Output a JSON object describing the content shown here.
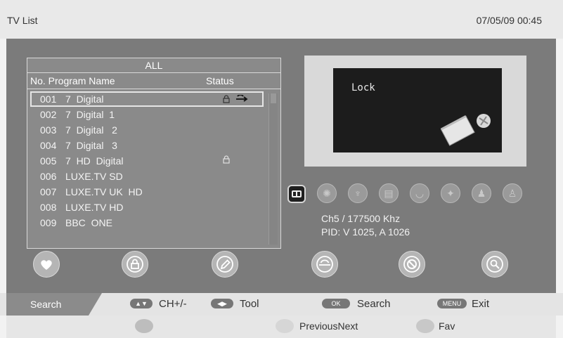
{
  "header": {
    "title": "TV List",
    "datetime": "07/05/09  00:45"
  },
  "list": {
    "group": "ALL",
    "col_no_name": "No. Program Name",
    "col_status": "Status",
    "channels": [
      {
        "no": "001",
        "name": "7  Digital",
        "locked": true,
        "skip": true
      },
      {
        "no": "002",
        "name": "7  Digital  1"
      },
      {
        "no": "003",
        "name": "7  Digital   2"
      },
      {
        "no": "004",
        "name": "7  Digital   3"
      },
      {
        "no": "005",
        "name": "7  HD  Digital",
        "locked": true
      },
      {
        "no": "006",
        "name": "LUXE.TV SD"
      },
      {
        "no": "007",
        "name": "LUXE.TV UK  HD"
      },
      {
        "no": "008",
        "name": "LUXE.TV HD"
      },
      {
        "no": "009",
        "name": "BBC  ONE"
      }
    ]
  },
  "preview": {
    "status_text": "Lock"
  },
  "info": {
    "frequency": "Ch5 / 177500  Khz",
    "pid": "PID: V 1025, A 1026"
  },
  "help": {
    "search_label": "Search",
    "ch_key": "▲▼",
    "ch_label": "CH+/-",
    "tool_key": "◀▶",
    "tool_label": "Tool",
    "ok_key": "OK",
    "ok_label": "Search",
    "menu_key": "MENU",
    "menu_label": "Exit"
  },
  "colors_hint": {
    "prevnext_label": "PreviousNext",
    "fav_label": "Fav",
    "red": "#c0c0c0",
    "green": "#cfcfcf",
    "yellow": "#dcdcdc",
    "blue": "#c4c4c4"
  }
}
